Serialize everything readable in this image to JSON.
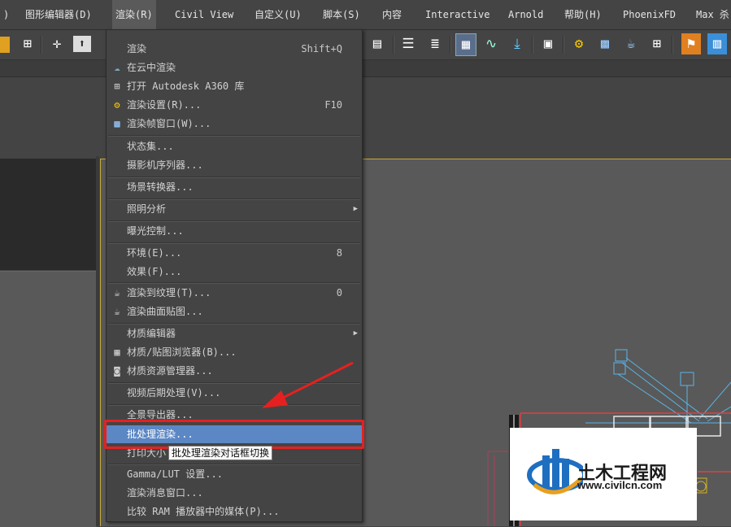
{
  "menubar": {
    "items": [
      {
        "label": ")"
      },
      {
        "label": "图形编辑器(D)"
      },
      {
        "label": "渲染(R)"
      },
      {
        "label": "Civil View"
      },
      {
        "label": "自定义(U)"
      },
      {
        "label": "脚本(S)"
      },
      {
        "label": "内容"
      },
      {
        "label": "Interactive"
      },
      {
        "label": "Arnold"
      },
      {
        "label": "帮助(H)"
      },
      {
        "label": "PhoenixFD"
      },
      {
        "label": "Max 杀"
      }
    ]
  },
  "render_menu": {
    "items": [
      {
        "label": "渲染",
        "shortcut": "Shift+Q",
        "icon": ""
      },
      {
        "label": "在云中渲染",
        "shortcut": "",
        "icon": "teapot-cloud-icon"
      },
      {
        "label": "打开 Autodesk A360 库",
        "shortcut": "",
        "icon": "grid-library-icon"
      },
      {
        "label": "渲染设置(R)...",
        "shortcut": "F10",
        "icon": "teapot-gear-icon"
      },
      {
        "label": "渲染帧窗口(W)...",
        "shortcut": "",
        "icon": "frame-window-icon"
      },
      {
        "label": "状态集...",
        "shortcut": "",
        "icon": ""
      },
      {
        "label": "摄影机序列器...",
        "shortcut": "",
        "icon": ""
      },
      {
        "label": "场景转换器...",
        "shortcut": "",
        "icon": ""
      },
      {
        "label": "照明分析",
        "shortcut": "",
        "icon": "",
        "submenu": true
      },
      {
        "label": "曝光控制...",
        "shortcut": "",
        "icon": ""
      },
      {
        "label": "环境(E)...",
        "shortcut": "8",
        "icon": ""
      },
      {
        "label": "效果(F)...",
        "shortcut": "",
        "icon": ""
      },
      {
        "label": "渲染到纹理(T)...",
        "shortcut": "0",
        "icon": "teapot-texture-icon"
      },
      {
        "label": "渲染曲面贴图...",
        "shortcut": "",
        "icon": "teapot-surface-icon"
      },
      {
        "label": "材质编辑器",
        "shortcut": "",
        "icon": "",
        "submenu": true
      },
      {
        "label": "材质/贴图浏览器(B)...",
        "shortcut": "",
        "icon": "material-browser-icon"
      },
      {
        "label": "材质资源管理器...",
        "shortcut": "",
        "icon": "material-explorer-icon"
      },
      {
        "label": "视频后期处理(V)...",
        "shortcut": "",
        "icon": ""
      },
      {
        "label": "全景导出器...",
        "shortcut": "",
        "icon": ""
      },
      {
        "label": "批处理渲染...",
        "shortcut": "",
        "icon": ""
      },
      {
        "label": "打印大小",
        "shortcut": "",
        "icon": ""
      },
      {
        "label": "Gamma/LUT 设置...",
        "shortcut": "",
        "icon": ""
      },
      {
        "label": "渲染消息窗口...",
        "shortcut": "",
        "icon": ""
      },
      {
        "label": "比较 RAM 播放器中的媒体(P)...",
        "shortcut": "",
        "icon": ""
      }
    ]
  },
  "tooltip": {
    "text": "批处理渲染对话框切换"
  },
  "watermark": {
    "title": "土木工程网",
    "url": "www.civilcn.com"
  },
  "colors": {
    "highlight": "#5b87c4",
    "annotation": "#e62020",
    "viewport_border": "#c8a838"
  }
}
